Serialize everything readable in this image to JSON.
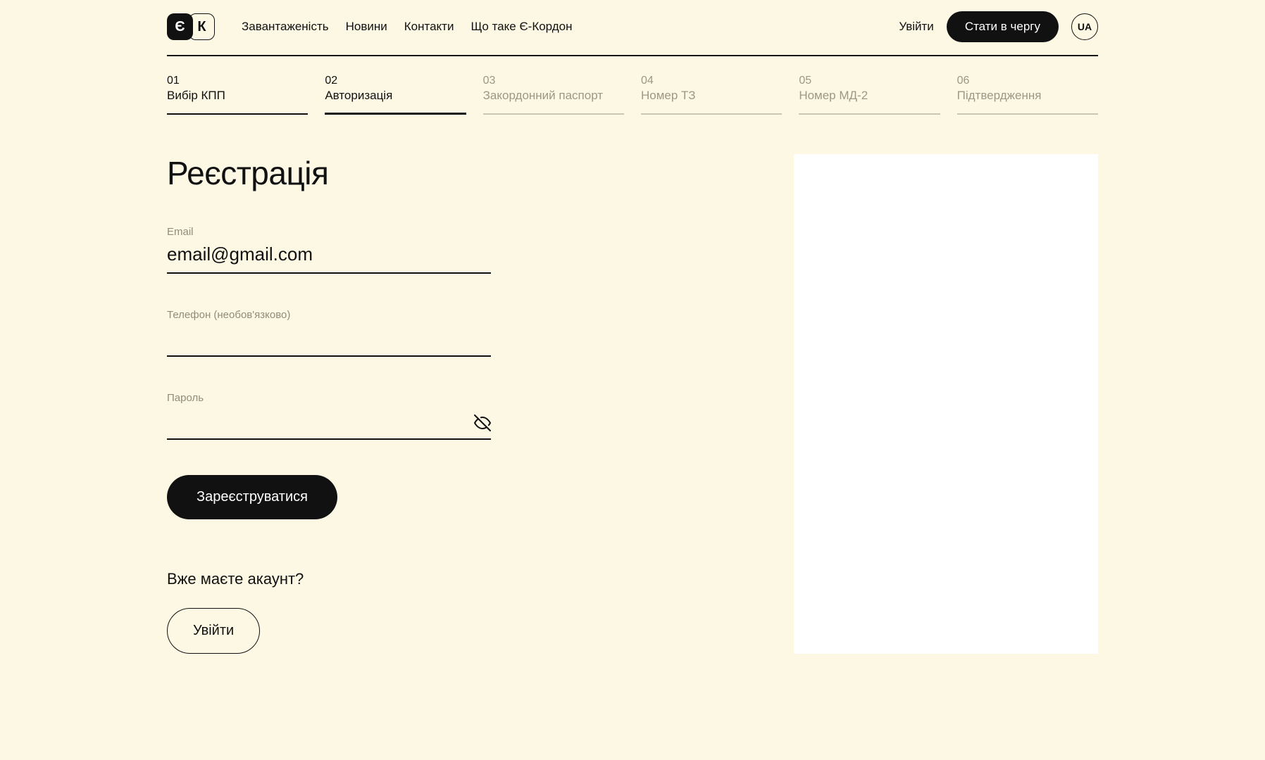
{
  "header": {
    "logo_left": "Є",
    "logo_right": "К",
    "nav": {
      "load": "Завантаженість",
      "news": "Новини",
      "contacts": "Контакти",
      "about": "Що таке Є-Кордон"
    },
    "login": "Увійти",
    "cta": "Стати в чергу",
    "lang": "UA"
  },
  "steps": [
    {
      "num": "01",
      "label": "Вибір КПП",
      "state": "completed"
    },
    {
      "num": "02",
      "label": "Авторизація",
      "state": "active"
    },
    {
      "num": "03",
      "label": "Закордонний паспорт",
      "state": "disabled"
    },
    {
      "num": "04",
      "label": "Номер ТЗ",
      "state": "disabled"
    },
    {
      "num": "05",
      "label": "Номер МД-2",
      "state": "disabled"
    },
    {
      "num": "06",
      "label": "Підтвердження",
      "state": "disabled"
    }
  ],
  "form": {
    "title": "Реєстрація",
    "email_label": "Email",
    "email_value": "email@gmail.com",
    "phone_label": "Телефон (необов'язково)",
    "phone_value": "",
    "password_label": "Пароль",
    "password_value": "",
    "submit": "Зареєструватися"
  },
  "already": {
    "title": "Вже маєте акаунт?",
    "login_btn": "Увійти"
  }
}
